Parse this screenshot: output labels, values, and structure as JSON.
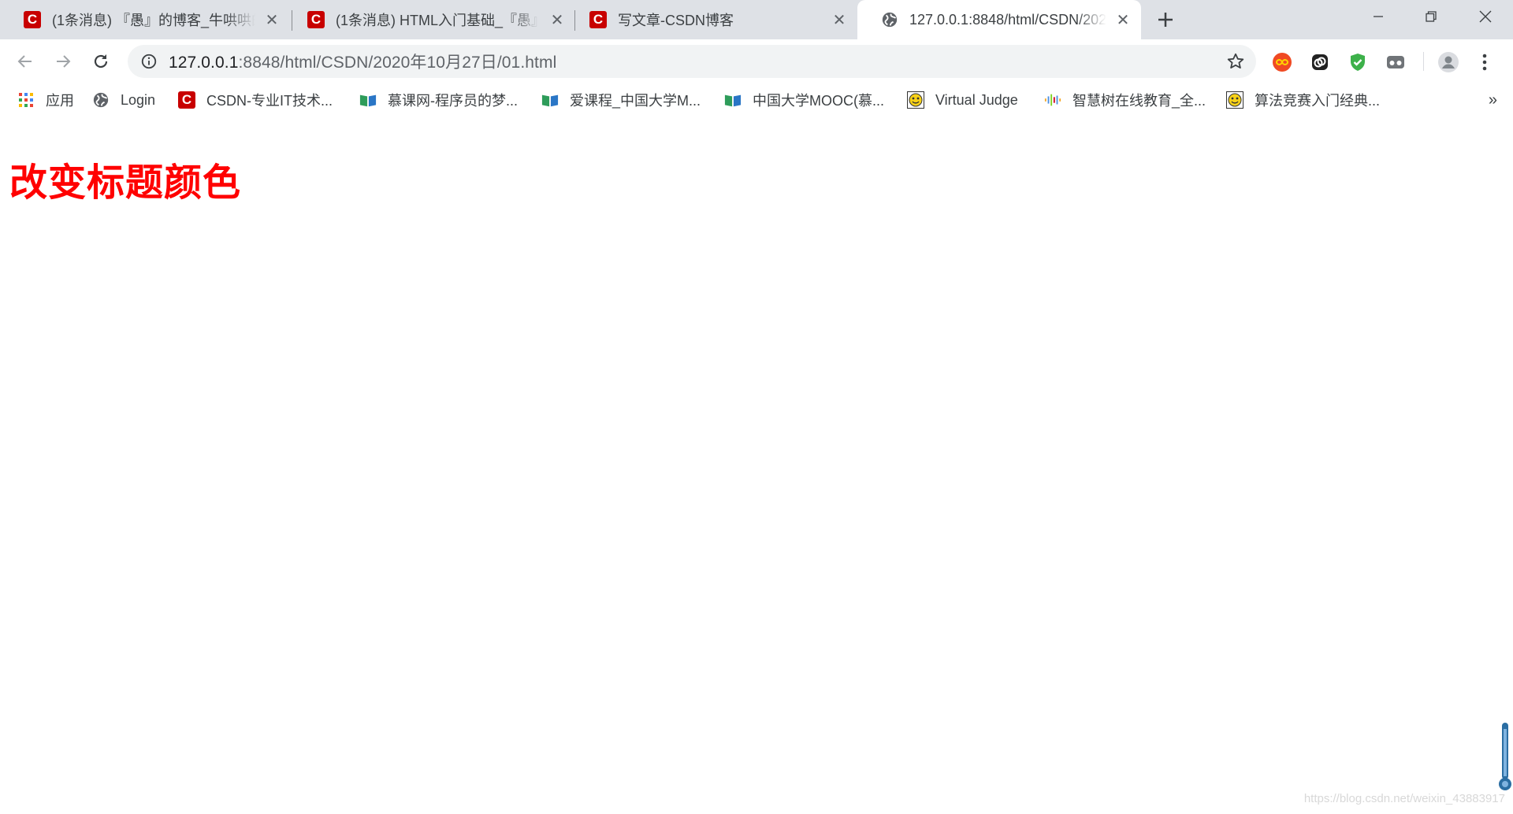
{
  "tabs": [
    {
      "title": "(1条消息) 『愚』的博客_牛哄哄的",
      "icon": "csdn-icon",
      "active": false
    },
    {
      "title": "(1条消息) HTML入门基础_『愚』",
      "icon": "csdn-icon",
      "active": false
    },
    {
      "title": "写文章-CSDN博客",
      "icon": "csdn-icon",
      "active": false
    },
    {
      "title": "127.0.0.1:8848/html/CSDN/2020",
      "icon": "globe-icon",
      "active": true
    }
  ],
  "address": {
    "host": "127.0.0.1",
    "path": ":8848/html/CSDN/2020年10月27日/01.html"
  },
  "bookmarks": [
    {
      "label": "应用",
      "icon": "apps-grid-icon"
    },
    {
      "label": "Login",
      "icon": "globe-icon"
    },
    {
      "label": "CSDN-专业IT技术...",
      "icon": "csdn-icon"
    },
    {
      "label": "慕课网-程序员的梦...",
      "icon": "book-icon"
    },
    {
      "label": "爱课程_中国大学M...",
      "icon": "book-icon"
    },
    {
      "label": "中国大学MOOC(慕...",
      "icon": "book-icon"
    },
    {
      "label": "Virtual Judge",
      "icon": "smiley-icon"
    },
    {
      "label": "智慧树在线教育_全...",
      "icon": "soundwave-icon"
    },
    {
      "label": "算法竞赛入门经典...",
      "icon": "smiley-icon"
    }
  ],
  "bookmarks_more": "»",
  "page": {
    "heading": "改变标题颜色",
    "heading_color": "#ff0000",
    "watermark": "https://blog.csdn.net/weixin_43883917"
  }
}
